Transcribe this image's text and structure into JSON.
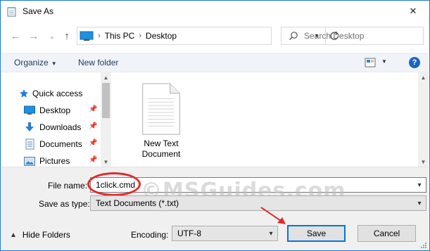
{
  "window": {
    "title": "Save As",
    "close_glyph": "✕"
  },
  "nav": {
    "back_glyph": "←",
    "forward_glyph": "→",
    "recent_glyph": "⌄",
    "up_glyph": "↑"
  },
  "address": {
    "crumbs": [
      "This PC",
      "Desktop"
    ],
    "separator": "›"
  },
  "search": {
    "placeholder": "Search Desktop"
  },
  "toolbar": {
    "organize_label": "Organize",
    "new_folder_label": "New folder",
    "help_label": "?"
  },
  "sidebar": {
    "items": [
      {
        "label": "Quick access",
        "icon": "star-icon",
        "pinned": false
      },
      {
        "label": "Desktop",
        "icon": "desktop-icon",
        "pinned": true
      },
      {
        "label": "Downloads",
        "icon": "download-icon",
        "pinned": true
      },
      {
        "label": "Documents",
        "icon": "documents-icon",
        "pinned": true
      },
      {
        "label": "Pictures",
        "icon": "pictures-icon",
        "pinned": true
      }
    ]
  },
  "files": [
    {
      "name": "New Text Document",
      "icon": "text-file-icon"
    }
  ],
  "form": {
    "file_name_label": "File name:",
    "file_name_value": "1click.cmd",
    "save_type_label": "Save as type:",
    "save_type_value": "Text Documents (*.txt)",
    "encoding_label": "Encoding:",
    "encoding_value": "UTF-8"
  },
  "footer": {
    "hide_folders_label": "Hide Folders",
    "save_label": "Save",
    "cancel_label": "Cancel"
  },
  "watermark": "©MSGuides.com",
  "colors": {
    "accent": "#0078d7",
    "annotation_red": "#e22a2a",
    "command_bar": "#f0f4f9"
  }
}
